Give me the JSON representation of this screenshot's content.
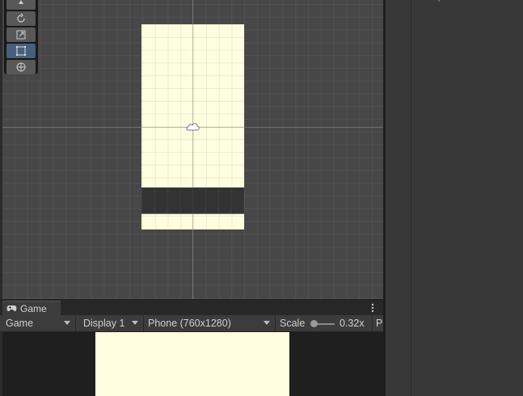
{
  "scene": {
    "tools": [
      {
        "name": "move-tool",
        "active": false
      },
      {
        "name": "rotate-tool",
        "active": false
      },
      {
        "name": "scale-tool",
        "active": false
      },
      {
        "name": "rect-tool",
        "active": true
      },
      {
        "name": "transform-tool",
        "active": false
      }
    ],
    "canvas_color": "#fefee0",
    "panel_color": "#333333"
  },
  "game": {
    "tab_label": "Game",
    "mode_label": "Game",
    "display_label": "Display 1",
    "resolution_label": "Phone (760x1280)",
    "scale_label": "Scale",
    "scale_value": "0.32x",
    "play_label": "P"
  },
  "colors": {
    "accent_active": "#46607c",
    "game_background": "#fffee0"
  }
}
